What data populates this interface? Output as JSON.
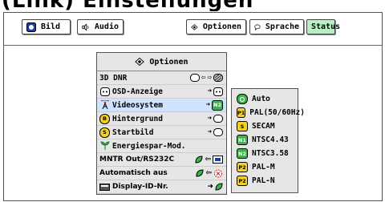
{
  "heading": "(Link) Einstellungen",
  "tabs": {
    "bild": "Bild",
    "audio": "Audio",
    "optionen": "Optionen",
    "sprache": "Sprache",
    "status": "Status"
  },
  "menu": {
    "title": "Optionen",
    "items": [
      {
        "label": "3D DNR"
      },
      {
        "label": "OSD-Anzeige"
      },
      {
        "label": "Videosystem",
        "value": "N2"
      },
      {
        "label": "Hintergrund",
        "badge": "B"
      },
      {
        "label": "Startbild",
        "badge": "S"
      },
      {
        "label": "Energiespar-Mod."
      },
      {
        "label": "MNTR Out/RS232C"
      },
      {
        "label": "Automatisch aus"
      },
      {
        "label": "Display-ID-Nr."
      }
    ]
  },
  "submenu": {
    "items": [
      {
        "badge": "",
        "label": "Auto"
      },
      {
        "badge": "P1",
        "label": "PAL(50/60Hz)"
      },
      {
        "badge": "S",
        "label": "SECAM"
      },
      {
        "badge": "N1",
        "label": "NTSC4.43"
      },
      {
        "badge": "N2",
        "label": "NTSC3.58"
      },
      {
        "badge": "P2",
        "label": "PAL-M"
      },
      {
        "badge": "P2",
        "label": "PAL-N"
      }
    ]
  },
  "colors": {
    "status_bg": "#b9f0c2",
    "green_badge": "#3bb54a",
    "yellow_badge": "#f3d024"
  }
}
